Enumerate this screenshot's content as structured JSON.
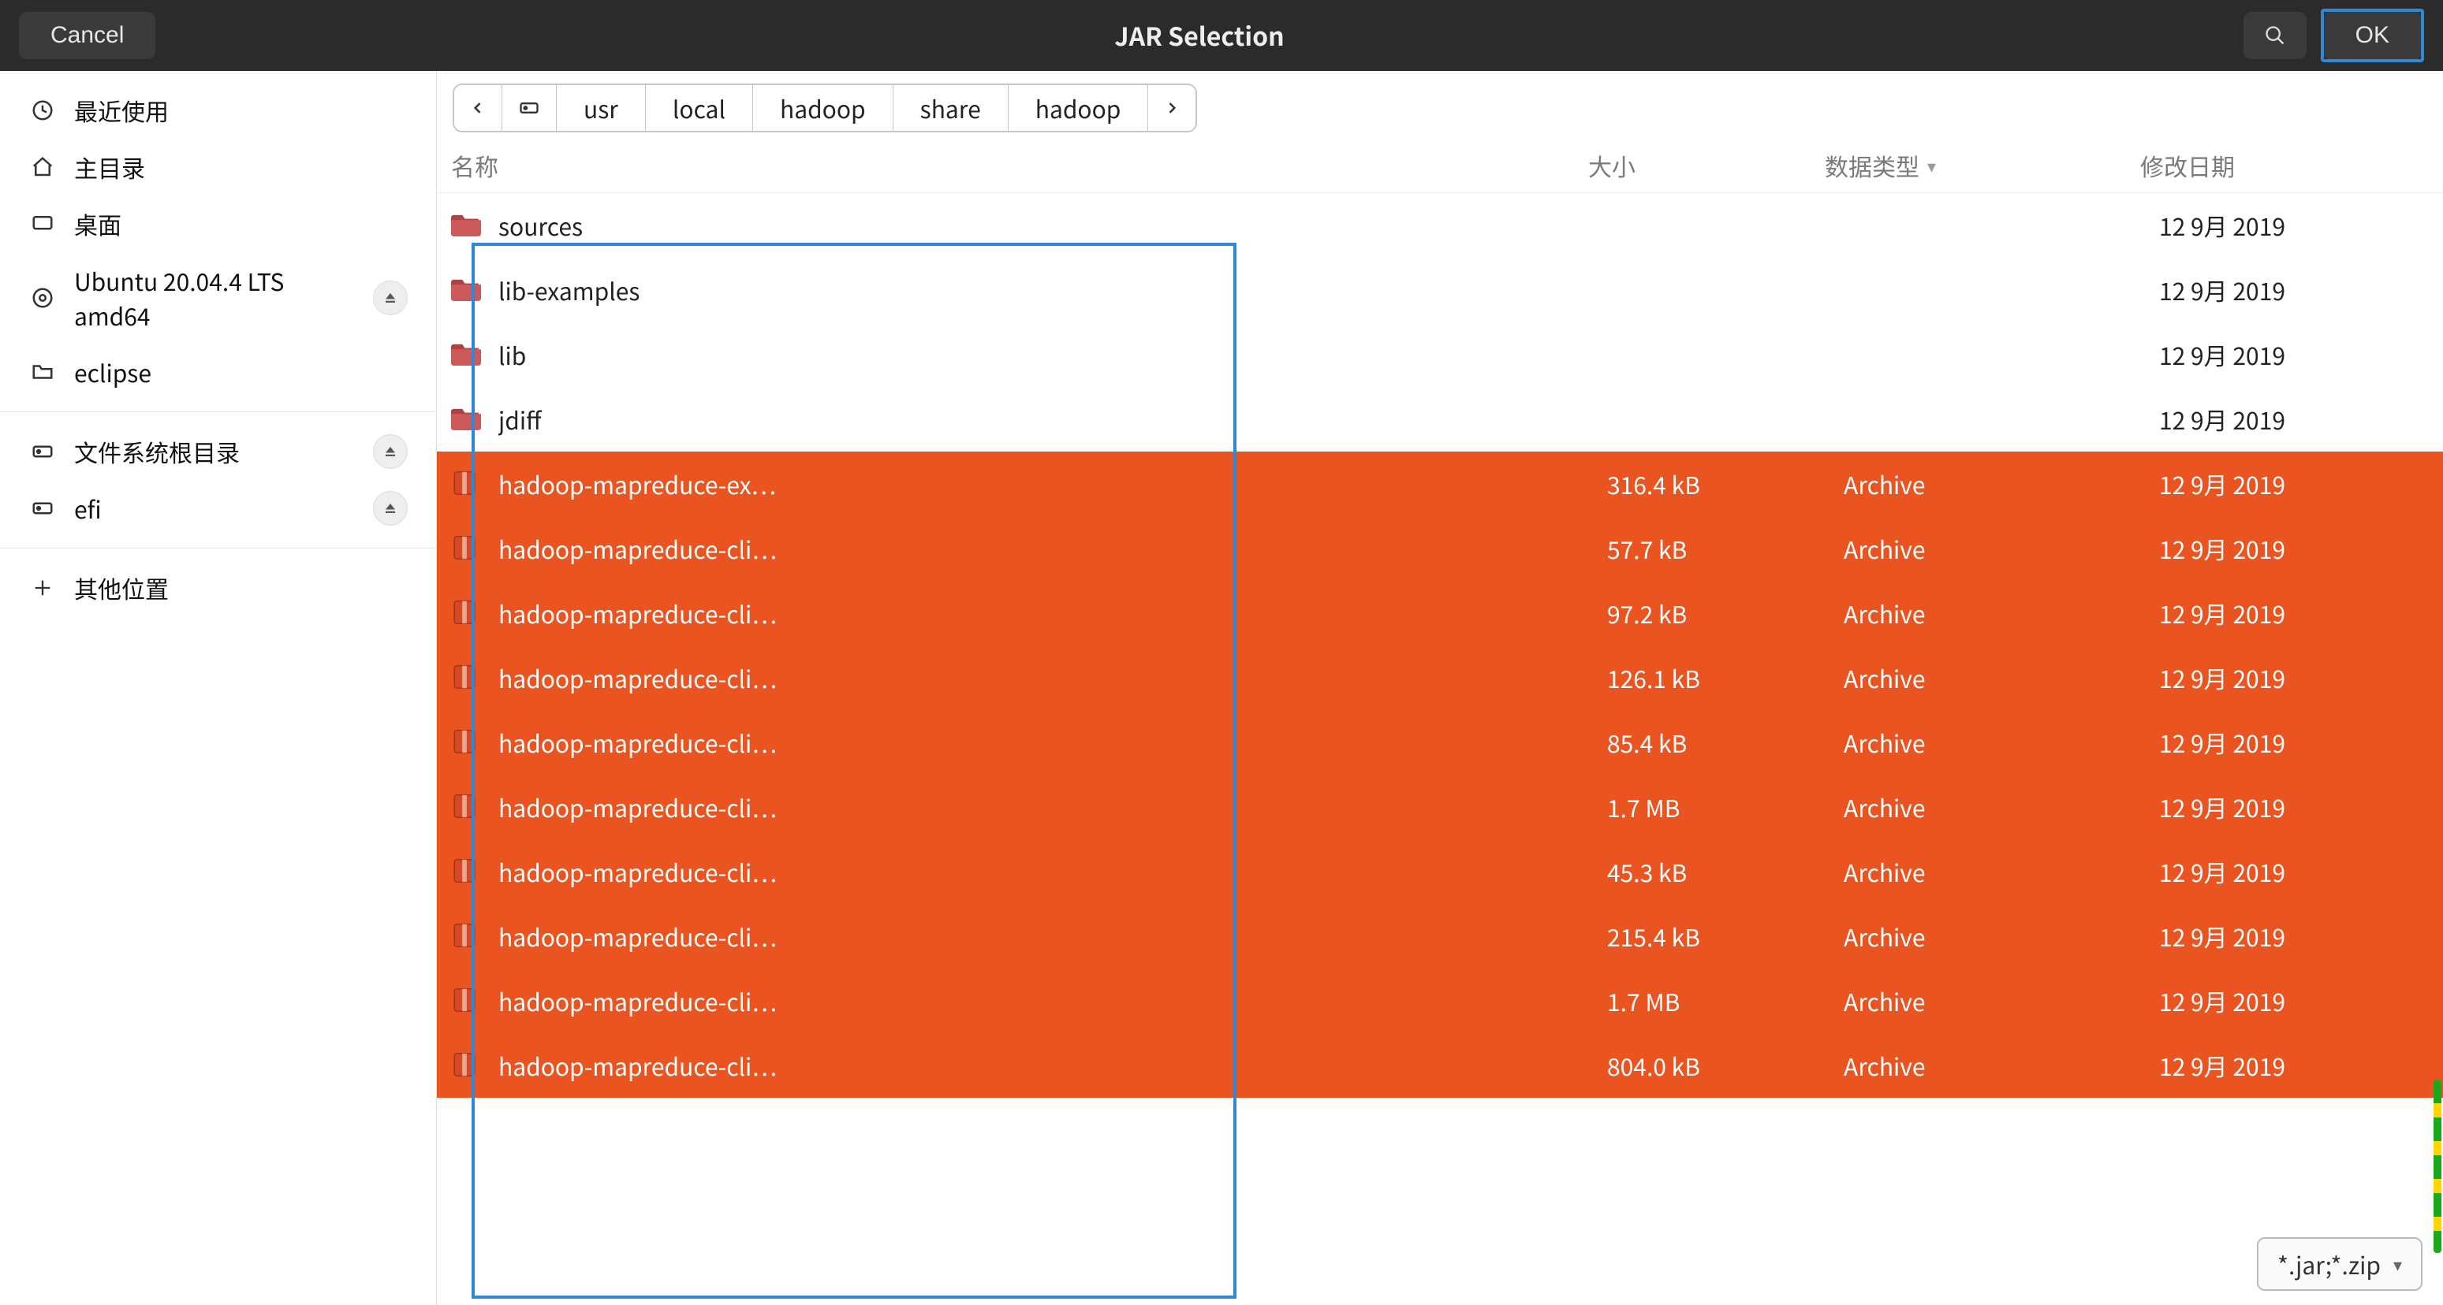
{
  "header": {
    "cancel_label": "Cancel",
    "title": "JAR Selection",
    "search_aria": "Search",
    "ok_label": "OK"
  },
  "sidebar": {
    "recent": "最近使用",
    "home": "主目录",
    "desktop": "桌面",
    "iso_label": "Ubuntu 20.04.4 LTS amd64",
    "eclipse": "eclipse",
    "fsroot": "文件系统根目录",
    "efi": "efi",
    "other": "其他位置"
  },
  "breadcrumbs": {
    "items": [
      "usr",
      "local",
      "hadoop",
      "share",
      "hadoop"
    ]
  },
  "columns": {
    "name": "名称",
    "size": "大小",
    "type": "数据类型",
    "modified": "修改日期"
  },
  "files": [
    {
      "name": "sources",
      "size": "",
      "type": "",
      "date": "12 9月 2019",
      "kind": "folder",
      "selected": false
    },
    {
      "name": "lib-examples",
      "size": "",
      "type": "",
      "date": "12 9月 2019",
      "kind": "folder",
      "selected": false
    },
    {
      "name": "lib",
      "size": "",
      "type": "",
      "date": "12 9月 2019",
      "kind": "folder",
      "selected": false
    },
    {
      "name": "jdiff",
      "size": "",
      "type": "",
      "date": "12 9月 2019",
      "kind": "folder",
      "selected": false
    },
    {
      "name": "hadoop-mapreduce-ex…",
      "size": "316.4 kB",
      "type": "Archive",
      "date": "12 9月 2019",
      "kind": "archive",
      "selected": true
    },
    {
      "name": "hadoop-mapreduce-cli…",
      "size": "57.7 kB",
      "type": "Archive",
      "date": "12 9月 2019",
      "kind": "archive",
      "selected": true
    },
    {
      "name": "hadoop-mapreduce-cli…",
      "size": "97.2 kB",
      "type": "Archive",
      "date": "12 9月 2019",
      "kind": "archive",
      "selected": true
    },
    {
      "name": "hadoop-mapreduce-cli…",
      "size": "126.1 kB",
      "type": "Archive",
      "date": "12 9月 2019",
      "kind": "archive",
      "selected": true
    },
    {
      "name": "hadoop-mapreduce-cli…",
      "size": "85.4 kB",
      "type": "Archive",
      "date": "12 9月 2019",
      "kind": "archive",
      "selected": true
    },
    {
      "name": "hadoop-mapreduce-cli…",
      "size": "1.7 MB",
      "type": "Archive",
      "date": "12 9月 2019",
      "kind": "archive",
      "selected": true
    },
    {
      "name": "hadoop-mapreduce-cli…",
      "size": "45.3 kB",
      "type": "Archive",
      "date": "12 9月 2019",
      "kind": "archive",
      "selected": true
    },
    {
      "name": "hadoop-mapreduce-cli…",
      "size": "215.4 kB",
      "type": "Archive",
      "date": "12 9月 2019",
      "kind": "archive",
      "selected": true
    },
    {
      "name": "hadoop-mapreduce-cli…",
      "size": "1.7 MB",
      "type": "Archive",
      "date": "12 9月 2019",
      "kind": "archive",
      "selected": true
    },
    {
      "name": "hadoop-mapreduce-cli…",
      "size": "804.0 kB",
      "type": "Archive",
      "date": "12 9月 2019",
      "kind": "archive",
      "selected": true
    }
  ],
  "filter": {
    "label": "*.jar;*.zip"
  }
}
